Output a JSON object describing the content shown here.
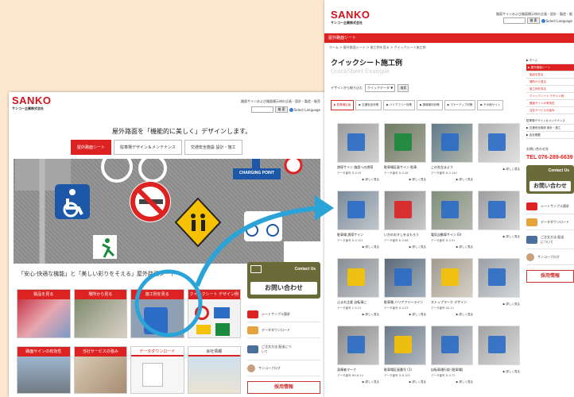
{
  "brand": {
    "logo": "SANKO",
    "company": "サンコー企業株式会社"
  },
  "w1": {
    "tagline_top": "路面サインおよび路面標示材の企画・設計・製造・販売",
    "search_btn": "検 索",
    "lang": "Select Language",
    "headline": "屋外路面を「機能的に美しく」デザインします。",
    "tabs": [
      "屋外路面シート",
      "駐車場デザイン＆メンテナンス",
      "交通安全施設 設計・施工"
    ],
    "hero_sign": "CHARGING POINT",
    "lower_headline": "「安心·快適な機能」と「美しい彩りをそえる」屋外路面シート",
    "grid_labels": [
      "製品を見る",
      "場所から見る",
      "施工例を見る",
      "クイックシート デザイン例"
    ],
    "grid_labels2": [
      "路面サインの有効性",
      "当社サービスの強み",
      "データダウンロード",
      "会社情報"
    ],
    "contact_small": "Contact Us",
    "contact_big": "お問い合わせ",
    "side_items": [
      "シートサンプル請求",
      "データダウンロード",
      "ご注文方法 配送について",
      "サンコーブログ"
    ],
    "recruit": "採用情報"
  },
  "w2": {
    "tagline_top": "路面サインおよび路面標示材の企画・設計・製造・販",
    "search_btn": "検 索",
    "lang": "Select Language",
    "redbar": "屋外路面シート",
    "crumb": "ホーム > 屋外路面シート > 施工例を見る > クイックシート施工例",
    "title": "クイックシート施工例",
    "subtitle": "QuickSheet Example",
    "filter_label": "デザインから絞り込む",
    "filter_value": "クイックデータ ▼",
    "filter_go": "検索",
    "ftabs": [
      "▶ 駐車場区画",
      "▶ 交通安全対策",
      "▶ バリアフリー対策",
      "▶ 誘導案内対策",
      "▶ マナーアップ対策",
      "▶ その他サイン"
    ],
    "cards": [
      {
        "t": "誘導サイン 施設への誘導",
        "m": "データ番号 D-0-45"
      },
      {
        "t": "駐車場区画サイン 駐車",
        "m": "データ番号 D-0-48"
      },
      {
        "t": "この先左まよう",
        "m": "データ番号 D-0-140"
      },
      {
        "t": "",
        "m": ""
      },
      {
        "t": "駐車場 誘導サイン",
        "m": "データ番号 D-0-101"
      },
      {
        "t": "いかのおすしをまもろう",
        "m": "データ番号 D-0-68"
      },
      {
        "t": "電気自動車サイン EV",
        "m": "データ番号 D-0-91"
      },
      {
        "t": "",
        "m": ""
      },
      {
        "t": "止まれ注意 自転車に",
        "m": "データ番号 C-9-13"
      },
      {
        "t": "駐車場 バリアフリーライン",
        "m": "データ番号 D-0-03"
      },
      {
        "t": "ストップマーク デザイン",
        "m": "データ番号 AS-12"
      },
      {
        "t": "",
        "m": ""
      },
      {
        "t": "身障者マーク",
        "m": "データ番号 BH-8-10"
      },
      {
        "t": "駐車場区画番号 (1)",
        "m": "データ番号 D-8-100"
      },
      {
        "t": "自転車通行部 (駐車場)",
        "m": "データ番号 D-9-72"
      },
      {
        "t": "",
        "m": ""
      }
    ],
    "more": "▶ 詳しく見る",
    "rnav": [
      "▶ ホーム",
      "▶ 屋外路面シート",
      "製品を見る",
      "場所から見る",
      "施工例を見る",
      "クイックシート デザイン例",
      "路面サインの有効性",
      "当社サービスの強み",
      "駐車場デザイン＆メンテナンス",
      "▶ 交通安全施設 設計・施工",
      "▶ 会社概要"
    ],
    "contact_label": "お問い合わせ先",
    "tel": "TEL 076-289-6639",
    "contact_small": "Contact Us",
    "contact_big": "お問い合わせ",
    "side_items": [
      "シートサンプル請求",
      "データダウンロード",
      "ご注文方法 配送について",
      "サンコーブログ"
    ],
    "recruit": "採用情報"
  }
}
